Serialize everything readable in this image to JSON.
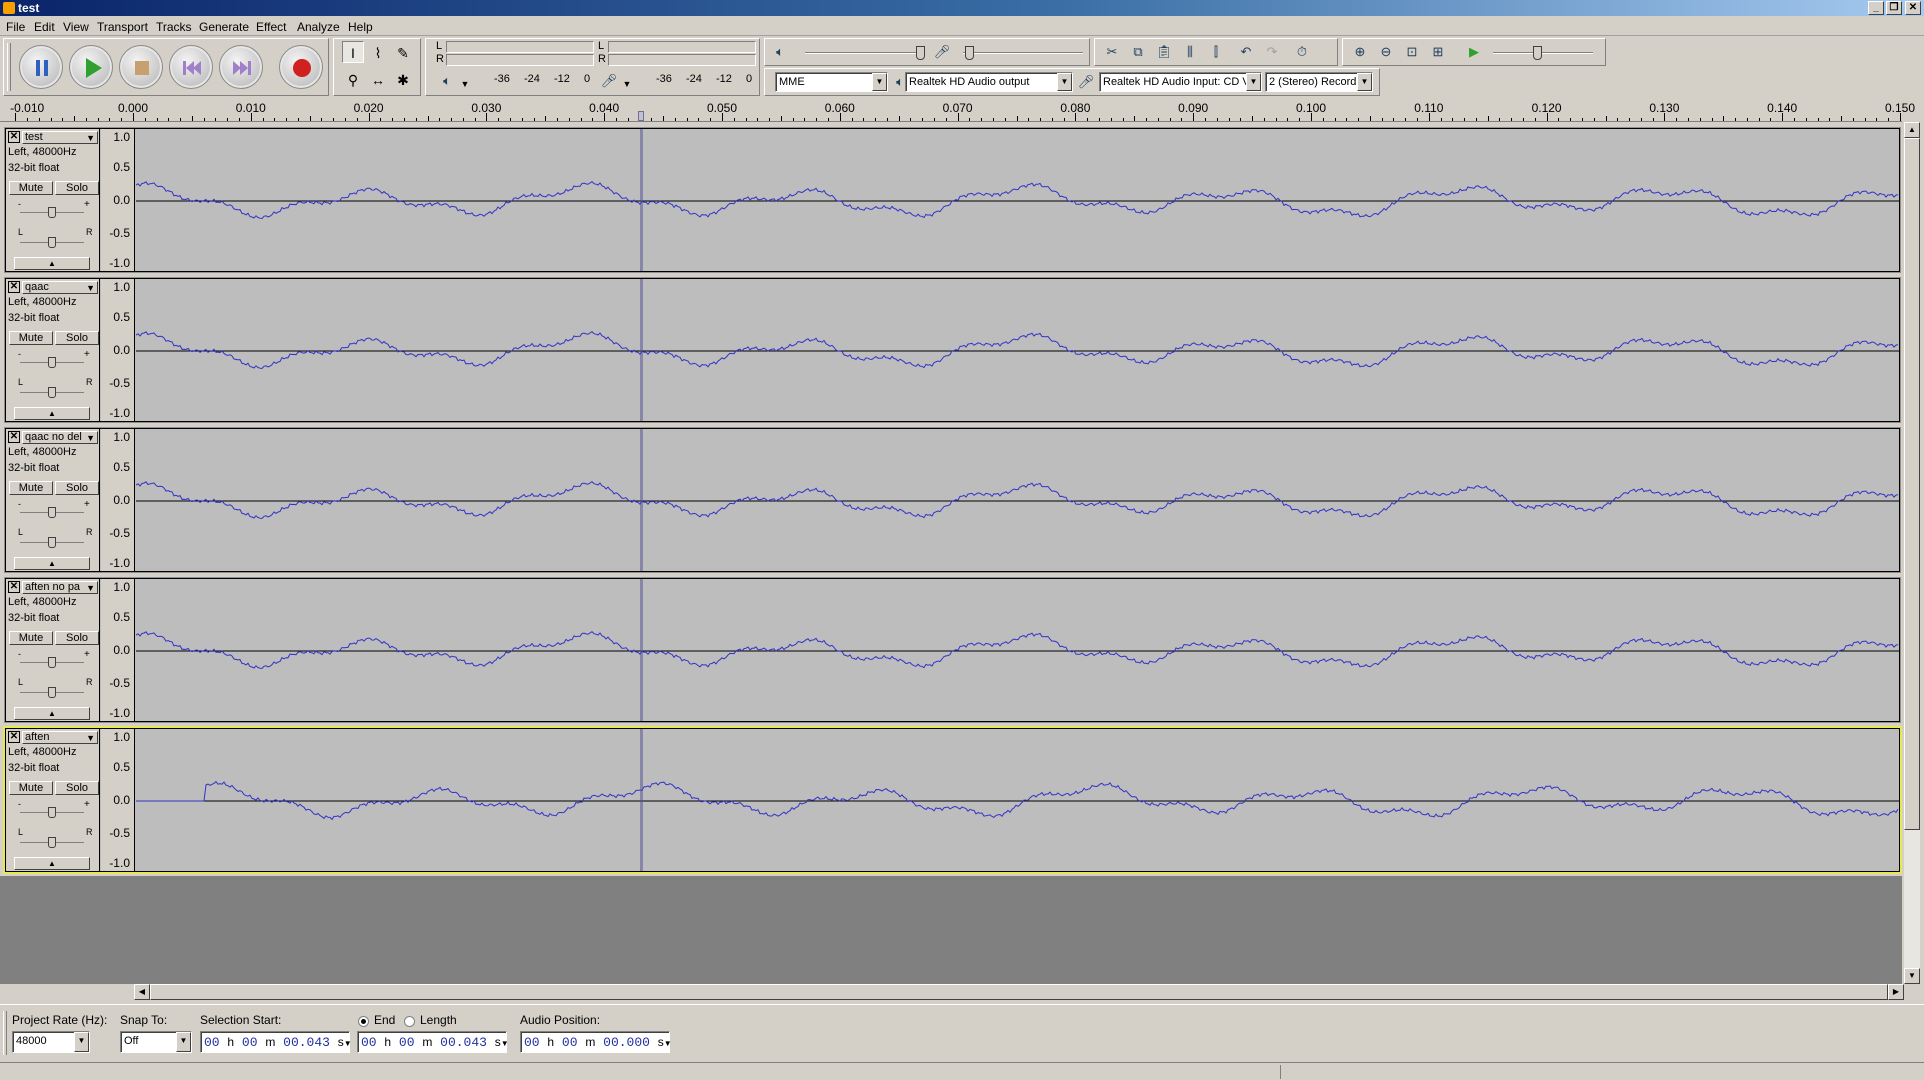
{
  "window": {
    "title": "test",
    "controls": [
      "minimize-icon",
      "restore-icon",
      "close-icon"
    ]
  },
  "menu": [
    "File",
    "Edit",
    "View",
    "Transport",
    "Tracks",
    "Generate",
    "Effect",
    "Analyze",
    "Help"
  ],
  "meters": {
    "playback_channels": [
      "L",
      "R"
    ],
    "record_channels": [
      "L",
      "R"
    ],
    "playback_scale": [
      "-36",
      "-24",
      "-12",
      "0"
    ],
    "record_scale": [
      "-36",
      "-24",
      "-12",
      "0"
    ]
  },
  "device": {
    "host": "MME",
    "output": "Realtek HD Audio output",
    "input": "Realtek HD Audio Input: CD Vc",
    "channels": "2 (Stereo) Record"
  },
  "ruler": {
    "labels": [
      "-0.010",
      "0.000",
      "0.010",
      "0.020",
      "0.030",
      "0.040",
      "0.050",
      "0.060",
      "0.070",
      "0.080",
      "0.090",
      "0.100",
      "0.110",
      "0.120",
      "0.130",
      "0.140",
      "0.150"
    ],
    "cursor_time": 0.043
  },
  "scale_labels": [
    "1.0",
    "0.5",
    "0.0",
    "-0.5",
    "-1.0"
  ],
  "track_common": {
    "format": "Left, 48000Hz",
    "bits": "32-bit float",
    "mute": "Mute",
    "solo": "Solo",
    "gain_minus": "-",
    "gain_plus": "+",
    "pan_l": "L",
    "pan_r": "R"
  },
  "tracks": [
    {
      "name": "test",
      "delay_start": null,
      "shift": 0,
      "focused": false
    },
    {
      "name": "qaac",
      "delay_start": null,
      "shift": 0,
      "focused": false
    },
    {
      "name": "qaac no del",
      "delay_start": 0.0,
      "shift": 0,
      "focused": false
    },
    {
      "name": "aften no pa",
      "delay_start": null,
      "shift": 0,
      "focused": false
    },
    {
      "name": "aften",
      "delay_start": 0.006,
      "shift": 0.006,
      "focused": true
    }
  ],
  "selection": {
    "project_rate_label": "Project Rate (Hz):",
    "project_rate": "48000",
    "snap_label": "Snap To:",
    "snap": "Off",
    "start_label": "Selection Start:",
    "end_label": "End",
    "length_label": "Length",
    "end_selected": true,
    "position_label": "Audio Position:",
    "start": {
      "h": "00",
      "m": "00",
      "s": "00.043"
    },
    "end": {
      "h": "00",
      "m": "00",
      "s": "00.043"
    },
    "position": {
      "h": "00",
      "m": "00",
      "s": "00.000"
    },
    "units": {
      "h": "h",
      "m": "m",
      "s": "s"
    }
  }
}
